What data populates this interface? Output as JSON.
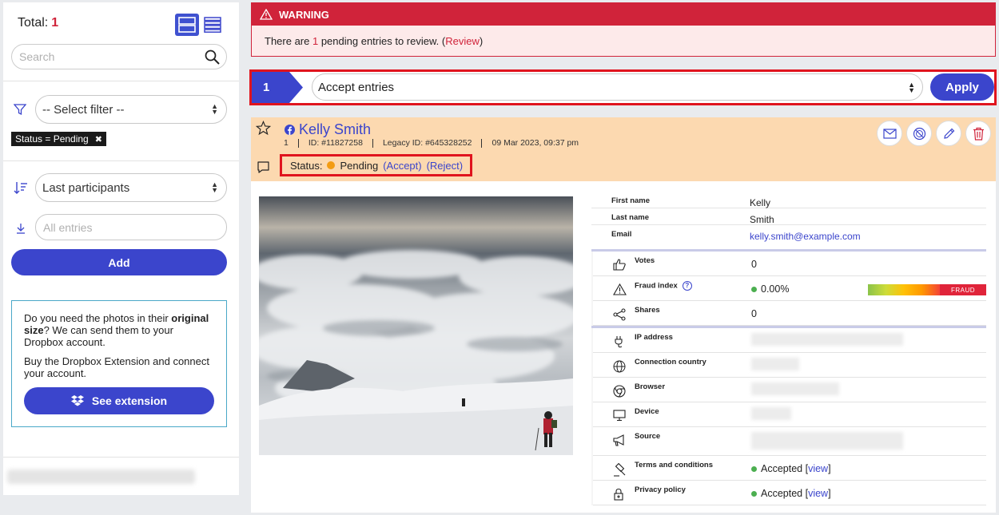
{
  "sidebar": {
    "total_label": "Total:",
    "total_count": "1",
    "search_placeholder": "Search",
    "filter_select": "-- Select filter --",
    "active_filter_chip": "Status = Pending",
    "sort_select": "Last participants",
    "entries_placeholder": "All entries",
    "add_label": "Add",
    "promo": {
      "line1_pre": "Do you need the photos in their ",
      "line1_bold": "original size",
      "line1_post": "? We can send them to your Dropbox account.",
      "line2": "Buy the Dropbox Extension and connect your account.",
      "button": "See extension"
    }
  },
  "warning": {
    "title": "WARNING",
    "msg_pre": "There are ",
    "msg_count": "1",
    "msg_mid": " pending entries to review. (",
    "msg_link": "Review",
    "msg_post": ")"
  },
  "actionbar": {
    "step": "1",
    "selected_action": "Accept entries",
    "apply_label": "Apply"
  },
  "entry": {
    "name": "Kelly Smith",
    "number": "1",
    "id": "ID: #11827258",
    "legacy_id": "Legacy ID: #645328252",
    "date": "09 Mar 2023, 09:37 pm",
    "status_label": "Status:",
    "status_value": "Pending",
    "accept_link": "(Accept)",
    "reject_link": "(Reject)",
    "fields": [
      {
        "label": "First name",
        "value": "Kelly"
      },
      {
        "label": "Last name",
        "value": "Smith"
      },
      {
        "label": "Email",
        "value": "kelly.smith@example.com"
      }
    ],
    "stats": {
      "votes_label": "Votes",
      "votes_value": "0",
      "fraud_label": "Fraud index",
      "fraud_value": "0.00%",
      "fraud_tag": "FRAUD",
      "shares_label": "Shares",
      "shares_value": "0",
      "ip_label": "IP address",
      "country_label": "Connection country",
      "browser_label": "Browser",
      "device_label": "Device",
      "source_label": "Source",
      "terms_label": "Terms and conditions",
      "terms_value": "Accepted [",
      "terms_link": "view",
      "privacy_label": "Privacy policy",
      "privacy_value": "Accepted [",
      "privacy_link": "view",
      "close_bracket": "]"
    }
  },
  "colors": {
    "accent": "#3b45cc",
    "danger": "#d0233a",
    "highlight_border": "#e0141e",
    "entry_header_bg": "#fcd9b0",
    "pending_dot": "#f39c12"
  }
}
